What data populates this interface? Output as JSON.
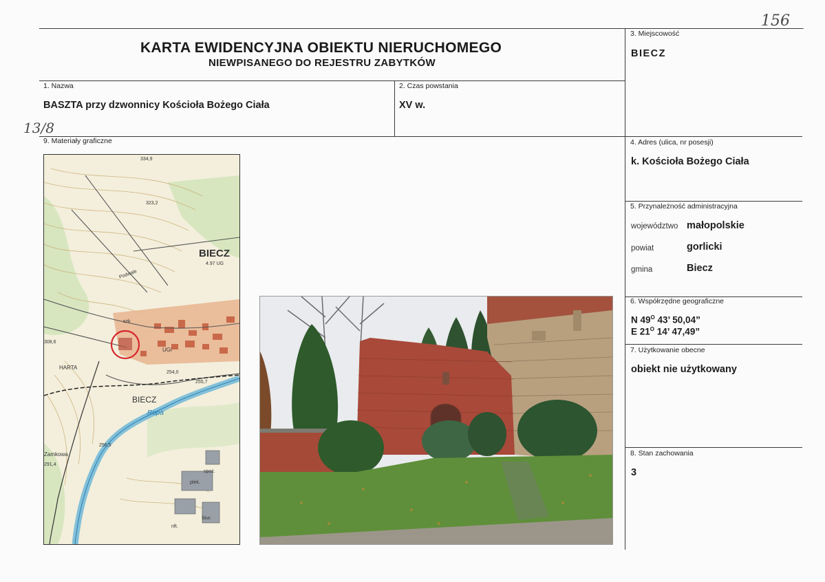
{
  "header": {
    "title_line1": "KARTA EWIDENCYJNA OBIEKTU NIERUCHOMEGO",
    "title_line2": "NIEWPISANEGO DO REJESTRU ZABYTKÓW",
    "page_number_handwritten": "156"
  },
  "fields": {
    "nazwa": {
      "label": "1. Nazwa",
      "value": "BASZTA przy dzwonnicy Kościoła Bożego Ciała"
    },
    "czas": {
      "label": "2. Czas powstania",
      "value": "XV w."
    },
    "miejscowosc": {
      "label": "3. Miejscowość",
      "value": "BIECZ"
    },
    "adres": {
      "label": "4. Adres (ulica, nr posesji)",
      "value": "k. Kościoła Bożego Ciała"
    },
    "przynaleznosc": {
      "label": "5. Przynależność administracyjna",
      "wojewodztwo_label": "województwo",
      "wojewodztwo": "małopolskie",
      "powiat_label": "powiat",
      "powiat": "gorlicki",
      "gmina_label": "gmina",
      "gmina": "Biecz"
    },
    "wspolrzedne": {
      "label": "6. Współrzędne geograficzne",
      "n_prefix": "N 49",
      "n_deg": "O",
      "n_rest": " 43’ 50,04”",
      "e_prefix": "E 21",
      "e_deg": "O",
      "e_rest": " 14’ 47,49”"
    },
    "uzytkowanie": {
      "label": "7. Użytkowanie obecne",
      "value": "obiekt nie użytkowany"
    },
    "stan": {
      "label": "8. Stan zachowania",
      "value": "3"
    },
    "materialy": {
      "label": "9. Materiały graficzne",
      "handwritten_note": "13/8"
    }
  },
  "map_labels": {
    "biecz_top": "BIECZ",
    "biecz_num": "4.97 UG",
    "biecz_bottom": "BIECZ",
    "harta": "HARTA",
    "zamkowa": "Zamkowa",
    "ropa": "Ropa",
    "podwale": "Podwale",
    "spot1": "334,9",
    "spot2": "323,2",
    "spot3": "308,6",
    "spot4": "254,0",
    "spot5": "255,7",
    "spot6": "256,5",
    "spot7": "291,4",
    "szk": "szk",
    "ugi": "UGi",
    "biur": "biur.",
    "nft": "nft.",
    "spoz": "spoż.",
    "plek": "plek."
  }
}
